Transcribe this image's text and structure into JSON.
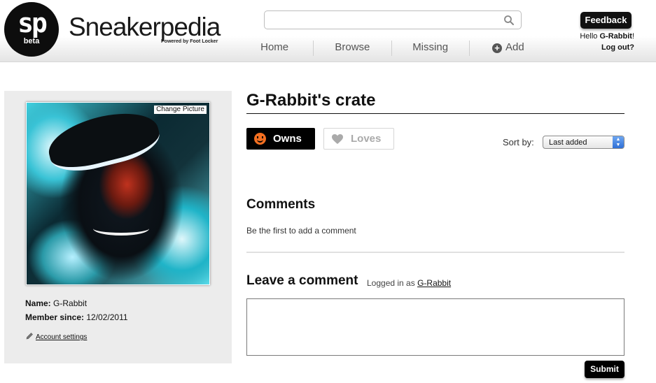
{
  "header": {
    "logo_mark": "sp",
    "logo_badge": "beta",
    "brand": "Sneakerpedia",
    "brand_tagline": "Powered by Foot Locker",
    "search": {
      "value": "",
      "placeholder": ""
    },
    "nav": [
      "Home",
      "Browse",
      "Missing",
      "Add"
    ],
    "feedback_label": "Feedback",
    "greeting_prefix": "Hello ",
    "username": "G-Rabbit",
    "greeting_suffix": "!",
    "logout_label": "Log out?"
  },
  "sidebar": {
    "change_picture_label": "Change Picture",
    "name_label": "Name:",
    "name_value": "G-Rabbit",
    "member_since_label": "Member since:",
    "member_since_value": "12/02/2011",
    "account_settings_label": "Account settings"
  },
  "main": {
    "title": "G-Rabbit's crate",
    "tabs": [
      {
        "label": "Owns",
        "active": true,
        "icon": "smiley-icon"
      },
      {
        "label": "Loves",
        "active": false,
        "icon": "heart-icon"
      }
    ],
    "sort_label": "Sort by:",
    "sort_value": "Last added",
    "comments_heading": "Comments",
    "no_comments_text": "Be the first to add a comment",
    "leave_comment_heading": "Leave a comment",
    "logged_in_prefix": "Logged in as",
    "logged_in_user": "G-Rabbit",
    "comment_value": "",
    "submit_label": "Submit"
  },
  "colors": {
    "accent_orange": "#f36f21",
    "button_black": "#000000",
    "sidebar_bg": "#ececec"
  }
}
